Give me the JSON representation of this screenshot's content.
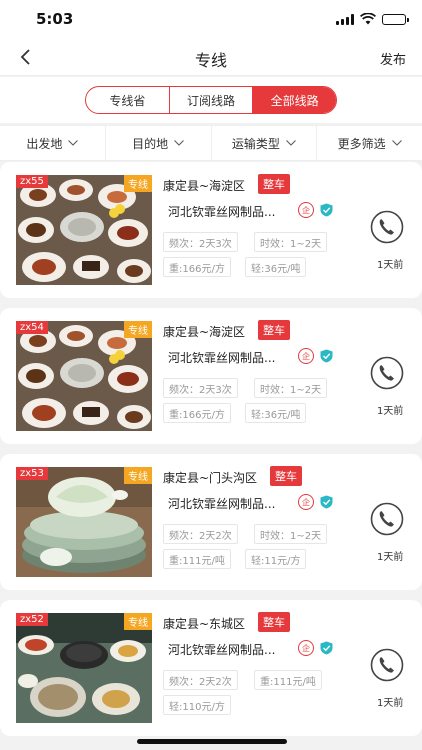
{
  "status_bar": {
    "time": "5:03",
    "icons": [
      "signal-icon",
      "wifi-icon",
      "battery-icon"
    ]
  },
  "nav": {
    "title": "专线",
    "publish": "发布",
    "back_icon": "chevron-left-icon"
  },
  "segments": [
    {
      "label": "专线省",
      "active": false
    },
    {
      "label": "订阅线路",
      "active": false
    },
    {
      "label": "全部线路",
      "active": true
    }
  ],
  "filters": [
    {
      "label": "出发地"
    },
    {
      "label": "目的地"
    },
    {
      "label": "运输类型"
    },
    {
      "label": "更多筛选"
    }
  ],
  "colors": {
    "accent": "#e5393b",
    "tag_orange": "#f5a623",
    "verify": "#2bb8c4",
    "page_bg": "#f2f2f2"
  },
  "cards": [
    {
      "code": "zx55",
      "tag": "专线",
      "route": "康定县~海淀区",
      "type_badge": "整车",
      "company": "河北钦霏丝网制品...",
      "ent_label": "企",
      "pills": [
        "频次：2天3次",
        "时效：1~2天",
        "重:166元/方",
        "轻:36元/吨"
      ],
      "ago": "1天前",
      "image": "food-platter"
    },
    {
      "code": "zx54",
      "tag": "专线",
      "route": "康定县~海淀区",
      "type_badge": "整车",
      "company": "河北钦霏丝网制品...",
      "ent_label": "企",
      "pills": [
        "频次：2天3次",
        "时效：1~2天",
        "重:166元/方",
        "轻:36元/吨"
      ],
      "ago": "1天前",
      "image": "food-platter"
    },
    {
      "code": "zx53",
      "tag": "专线",
      "route": "康定县~门头沟区",
      "type_badge": "整车",
      "company": "河北钦霏丝网制品...",
      "ent_label": "企",
      "pills": [
        "频次：2天2次",
        "时效：1~2天",
        "重:111元/吨",
        "轻:11元/方"
      ],
      "ago": "1天前",
      "image": "cabbage-plate"
    },
    {
      "code": "zx52",
      "tag": "专线",
      "route": "康定县~东城区",
      "type_badge": "整车",
      "company": "河北钦霏丝网制品...",
      "ent_label": "企",
      "pills": [
        "频次：2天2次",
        "重:111元/吨",
        "轻:110元/方"
      ],
      "ago": "1天前",
      "image": "hotpot-table"
    }
  ]
}
